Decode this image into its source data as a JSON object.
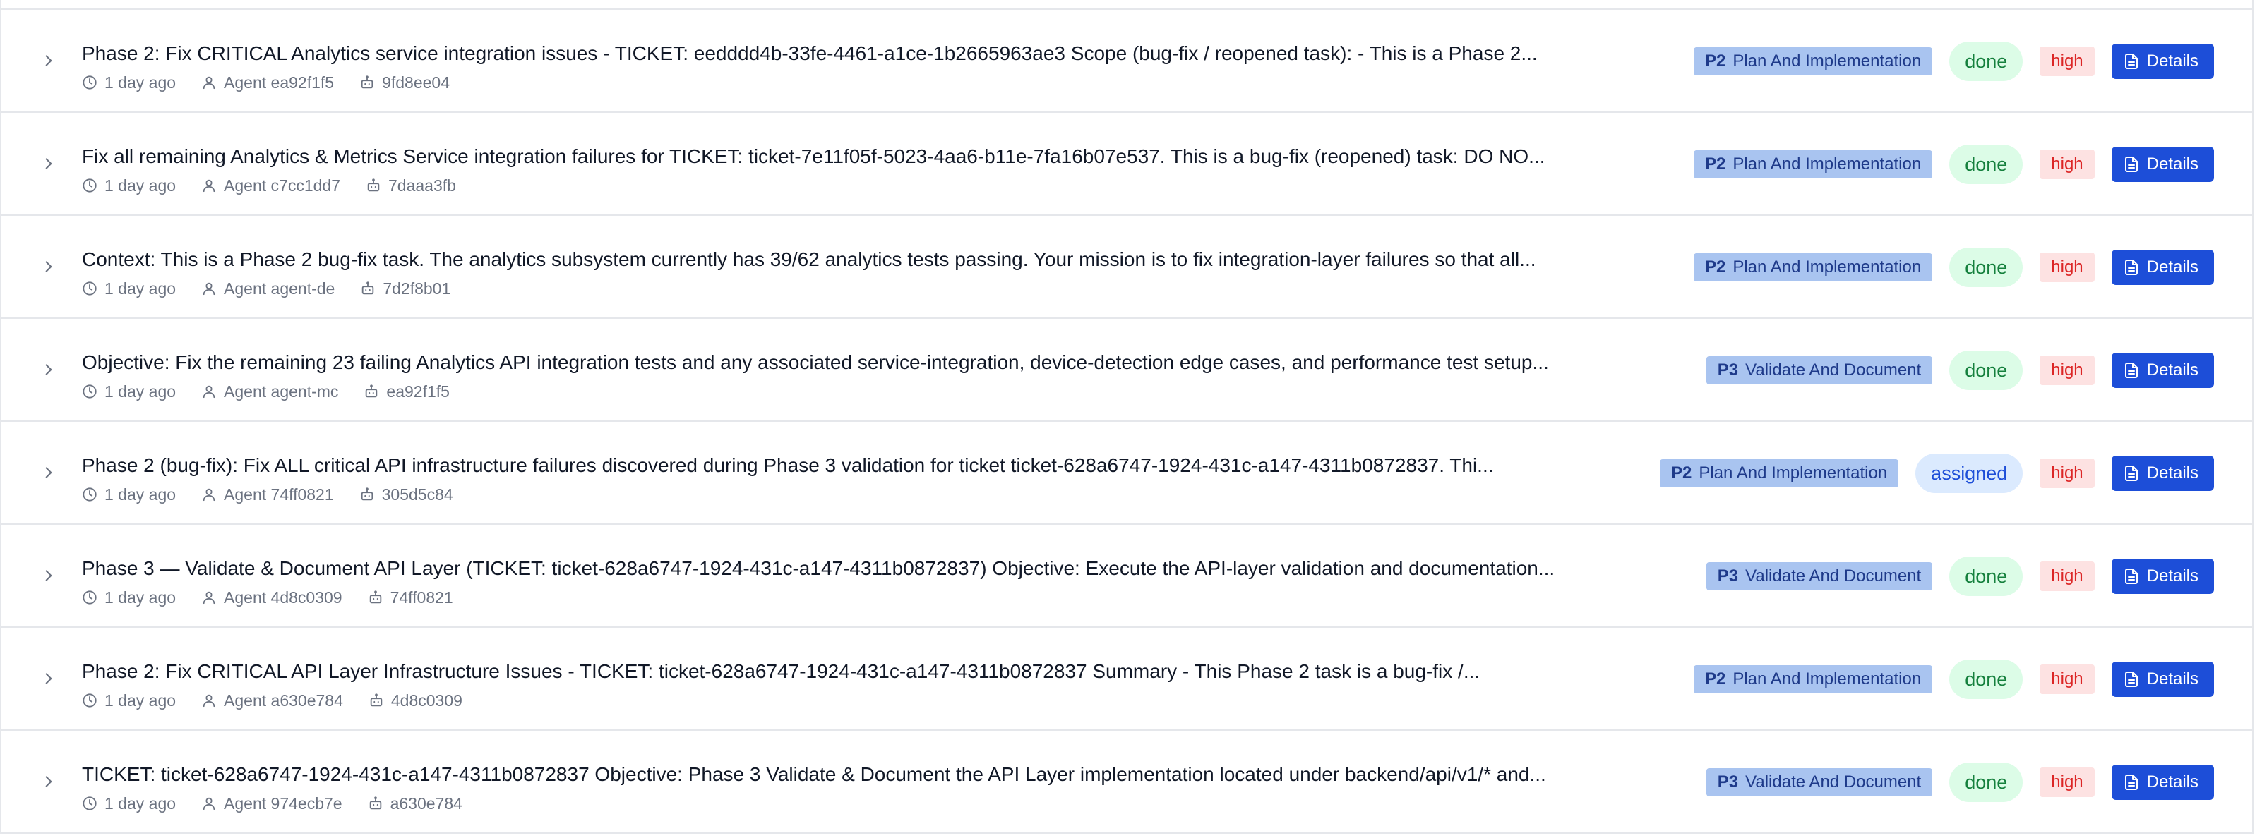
{
  "rows": [
    {
      "title": "Phase 2: Fix CRITICAL Analytics service integration issues - TICKET: eedddd4b-33fe-4461-a1ce-1b2665963ae3 Scope (bug-fix / reopened task): - This is a Phase 2...",
      "time": "1 day ago",
      "agent": "Agent ea92f1f5",
      "ref": "9fd8ee04",
      "phase_code": "P2",
      "phase_label": "Plan And Implementation",
      "status": "done",
      "priority": "high",
      "details_label": "Details"
    },
    {
      "title": "Fix all remaining Analytics & Metrics Service integration failures for TICKET: ticket-7e11f05f-5023-4aa6-b11e-7fa16b07e537. This is a bug-fix (reopened) task: DO NO...",
      "time": "1 day ago",
      "agent": "Agent c7cc1dd7",
      "ref": "7daaa3fb",
      "phase_code": "P2",
      "phase_label": "Plan And Implementation",
      "status": "done",
      "priority": "high",
      "details_label": "Details"
    },
    {
      "title": "Context: This is a Phase 2 bug-fix task. The analytics subsystem currently has 39/62 analytics tests passing. Your mission is to fix integration-layer failures so that all...",
      "time": "1 day ago",
      "agent": "Agent agent-de",
      "ref": "7d2f8b01",
      "phase_code": "P2",
      "phase_label": "Plan And Implementation",
      "status": "done",
      "priority": "high",
      "details_label": "Details"
    },
    {
      "title": "Objective: Fix the remaining 23 failing Analytics API integration tests and any associated service-integration, device-detection edge cases, and performance test setup...",
      "time": "1 day ago",
      "agent": "Agent agent-mc",
      "ref": "ea92f1f5",
      "phase_code": "P3",
      "phase_label": "Validate And Document",
      "status": "done",
      "priority": "high",
      "details_label": "Details"
    },
    {
      "title": "Phase 2 (bug-fix): Fix ALL critical API infrastructure failures discovered during Phase 3 validation for ticket ticket-628a6747-1924-431c-a147-4311b0872837. Thi...",
      "time": "1 day ago",
      "agent": "Agent 74ff0821",
      "ref": "305d5c84",
      "phase_code": "P2",
      "phase_label": "Plan And Implementation",
      "status": "assigned",
      "priority": "high",
      "details_label": "Details"
    },
    {
      "title": "Phase 3 — Validate & Document API Layer (TICKET: ticket-628a6747-1924-431c-a147-4311b0872837) Objective: Execute the API-layer validation and documentation...",
      "time": "1 day ago",
      "agent": "Agent 4d8c0309",
      "ref": "74ff0821",
      "phase_code": "P3",
      "phase_label": "Validate And Document",
      "status": "done",
      "priority": "high",
      "details_label": "Details"
    },
    {
      "title": "Phase 2: Fix CRITICAL API Layer Infrastructure Issues - TICKET: ticket-628a6747-1924-431c-a147-4311b0872837 Summary - This Phase 2 task is a bug-fix /...",
      "time": "1 day ago",
      "agent": "Agent a630e784",
      "ref": "4d8c0309",
      "phase_code": "P2",
      "phase_label": "Plan And Implementation",
      "status": "done",
      "priority": "high",
      "details_label": "Details"
    },
    {
      "title": "TICKET: ticket-628a6747-1924-431c-a147-4311b0872837 Objective: Phase 3 Validate & Document the API Layer implementation located under backend/api/v1/* and...",
      "time": "1 day ago",
      "agent": "Agent 974ecb7e",
      "ref": "a630e784",
      "phase_code": "P3",
      "phase_label": "Validate And Document",
      "status": "done",
      "priority": "high",
      "details_label": "Details"
    }
  ],
  "colors": {
    "phase_bg": "#a9c4f0",
    "phase_text": "#1e3a8a",
    "done_bg": "#dcfce7",
    "done_text": "#15803d",
    "assigned_bg": "#dbeafe",
    "assigned_text": "#1d4ed8",
    "priority_bg": "#fde2e2",
    "priority_text": "#dc2626",
    "details_bg": "#1d4ed8"
  },
  "icons": {
    "expand": "chevron-right-icon",
    "time": "clock-icon",
    "agent": "user-icon",
    "ref": "robot-icon",
    "details": "document-icon"
  }
}
